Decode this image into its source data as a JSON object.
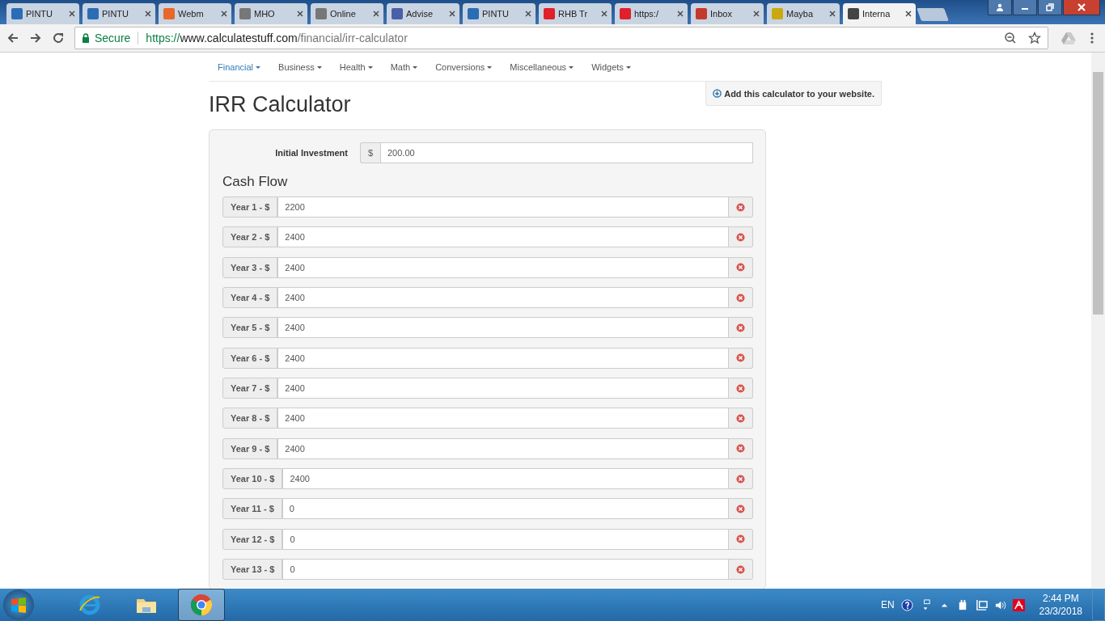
{
  "tabs": [
    {
      "title": "PINTU",
      "selected": false,
      "color": "#2a6db5"
    },
    {
      "title": "PINTU",
      "selected": false,
      "color": "#2a6db5"
    },
    {
      "title": "Webm",
      "selected": false,
      "color": "#e8672a"
    },
    {
      "title": "MHO",
      "selected": false,
      "color": "#777777"
    },
    {
      "title": "Online",
      "selected": false,
      "color": "#777777"
    },
    {
      "title": "Advise",
      "selected": false,
      "color": "#4a5fa8"
    },
    {
      "title": "PINTU",
      "selected": false,
      "color": "#2a6db5"
    },
    {
      "title": "RHB Tr",
      "selected": false,
      "color": "#e0202a"
    },
    {
      "title": "https:/",
      "selected": false,
      "color": "#e0202a"
    },
    {
      "title": "Inbox",
      "selected": false,
      "color": "#c5392b"
    },
    {
      "title": "Mayba",
      "selected": false,
      "color": "#c9a90e"
    },
    {
      "title": "Interna",
      "selected": true,
      "color": "#444444"
    }
  ],
  "address": {
    "secure_label": "Secure",
    "scheme": "https://",
    "host": "www.calculatestuff.com",
    "path": "/financial/irr-calculator"
  },
  "nav": [
    {
      "label": "Financial",
      "selected": true
    },
    {
      "label": "Business",
      "selected": false
    },
    {
      "label": "Health",
      "selected": false
    },
    {
      "label": "Math",
      "selected": false
    },
    {
      "label": "Conversions",
      "selected": false
    },
    {
      "label": "Miscellaneous",
      "selected": false
    },
    {
      "label": "Widgets",
      "selected": false
    }
  ],
  "add_button": "Add this calculator to your website.",
  "title": "IRR Calculator",
  "initial": {
    "label": "Initial Investment",
    "prefix": "$",
    "value": "200.00"
  },
  "cash_flow_heading": "Cash Flow",
  "cash_flows": [
    {
      "label": "Year 1 - $",
      "value": "2200"
    },
    {
      "label": "Year 2 - $",
      "value": "2400"
    },
    {
      "label": "Year 3 - $",
      "value": "2400"
    },
    {
      "label": "Year 4 - $",
      "value": "2400"
    },
    {
      "label": "Year 5 - $",
      "value": "2400"
    },
    {
      "label": "Year 6 - $",
      "value": "2400"
    },
    {
      "label": "Year 7 - $",
      "value": "2400"
    },
    {
      "label": "Year 8 - $",
      "value": "2400"
    },
    {
      "label": "Year 9 - $",
      "value": "2400"
    },
    {
      "label": "Year 10 - $",
      "value": "2400"
    },
    {
      "label": "Year 11 - $",
      "value": "0"
    },
    {
      "label": "Year 12 - $",
      "value": "0"
    },
    {
      "label": "Year 13 - $",
      "value": "0"
    }
  ],
  "taskbar": {
    "language": "EN",
    "time": "2:44 PM",
    "date": "23/3/2018"
  }
}
